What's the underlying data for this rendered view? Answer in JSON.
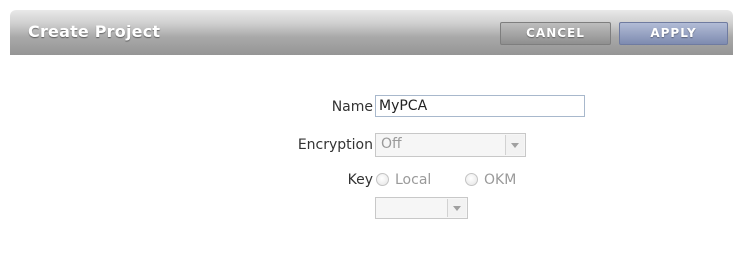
{
  "dialog": {
    "title": "Create Project",
    "cancel_label": "CANCEL",
    "apply_label": "APPLY"
  },
  "form": {
    "name_label": "Name",
    "name_value": "MyPCA",
    "encryption_label": "Encryption",
    "encryption_value": "Off",
    "key_label": "Key",
    "key_options": [
      "Local",
      "OKM"
    ],
    "key_select_value": ""
  }
}
